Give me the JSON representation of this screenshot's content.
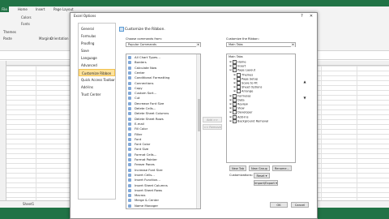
{
  "excel": {
    "file_tab": "File",
    "tabs": [
      "Home",
      "Insert",
      "Page Layout"
    ],
    "ribbon_items": [
      "Paste",
      "Colors",
      "Fonts",
      "Margins",
      "Orientation",
      "Themes"
    ],
    "sheet_tab": "Sheet1"
  },
  "dialog": {
    "title": "Excel Options",
    "close_glyph": "✕",
    "help_glyph": "?",
    "nav": [
      "General",
      "Formulas",
      "Proofing",
      "Save",
      "Language",
      "Advanced",
      "Customize Ribbon",
      "Quick Access Toolbar",
      "Add-Ins",
      "Trust Center"
    ],
    "nav_selected": 6,
    "heading": "Customize the Ribbon.",
    "choose_label": "Choose commands from:",
    "choose_value": "Popular Commands",
    "customize_label": "Customize the Ribbon:",
    "customize_value": "Main Tabs",
    "commands": [
      "All Chart Types...",
      "Borders",
      "Calculate Now",
      "Center",
      "Conditional Formatting",
      "Connections",
      "Copy",
      "Custom Sort...",
      "Cut",
      "Decrease Font Size",
      "Delete Cells...",
      "Delete Sheet Columns",
      "Delete Sheet Rows",
      "E-mail",
      "Fill Color",
      "Filter",
      "Font",
      "Font Color",
      "Font Size",
      "Format Cells...",
      "Format Painter",
      "Freeze Panes",
      "Increase Font Size",
      "Insert Cells...",
      "Insert Function...",
      "Insert Sheet Columns",
      "Insert Sheet Rows",
      "Macros",
      "Merge & Center",
      "Name Manager"
    ],
    "add_button": "Add >>",
    "remove_button": "<< Remove",
    "tree_title": "Main Tabs",
    "tree": [
      {
        "level": 0,
        "exp": "⊞",
        "checked": true,
        "label": "Home"
      },
      {
        "level": 0,
        "exp": "⊞",
        "checked": true,
        "label": "Insert"
      },
      {
        "level": 0,
        "exp": "⊟",
        "checked": true,
        "label": "Page Layout"
      },
      {
        "level": 1,
        "exp": "⊞",
        "checked": false,
        "label": "Themes"
      },
      {
        "level": 1,
        "exp": "⊞",
        "checked": false,
        "label": "Page Setup"
      },
      {
        "level": 1,
        "exp": "⊞",
        "checked": false,
        "label": "Scale to Fit"
      },
      {
        "level": 1,
        "exp": "⊞",
        "checked": false,
        "label": "Sheet Options"
      },
      {
        "level": 1,
        "exp": "⊞",
        "checked": false,
        "label": "Arrange"
      },
      {
        "level": 0,
        "exp": "⊞",
        "checked": true,
        "label": "Formulas"
      },
      {
        "level": 0,
        "exp": "⊞",
        "checked": true,
        "label": "Data"
      },
      {
        "level": 0,
        "exp": "⊞",
        "checked": true,
        "label": "Review"
      },
      {
        "level": 0,
        "exp": "⊞",
        "checked": true,
        "label": "View"
      },
      {
        "level": 0,
        "exp": "⊞",
        "checked": false,
        "label": "Developer"
      },
      {
        "level": 0,
        "exp": "⊞",
        "checked": true,
        "label": "Add-Ins"
      },
      {
        "level": 0,
        "exp": "⊞",
        "checked": true,
        "label": "Background Removal"
      }
    ],
    "new_tab_button": "New Tab",
    "new_group_button": "New Group",
    "rename_button": "Rename...",
    "customizations_label": "Customizations:",
    "reset_button": "Reset ▾",
    "import_export_button": "Import/Export ▾",
    "ok_button": "OK",
    "cancel_button": "Cancel",
    "up_glyph": "▲",
    "down_glyph": "▼"
  }
}
